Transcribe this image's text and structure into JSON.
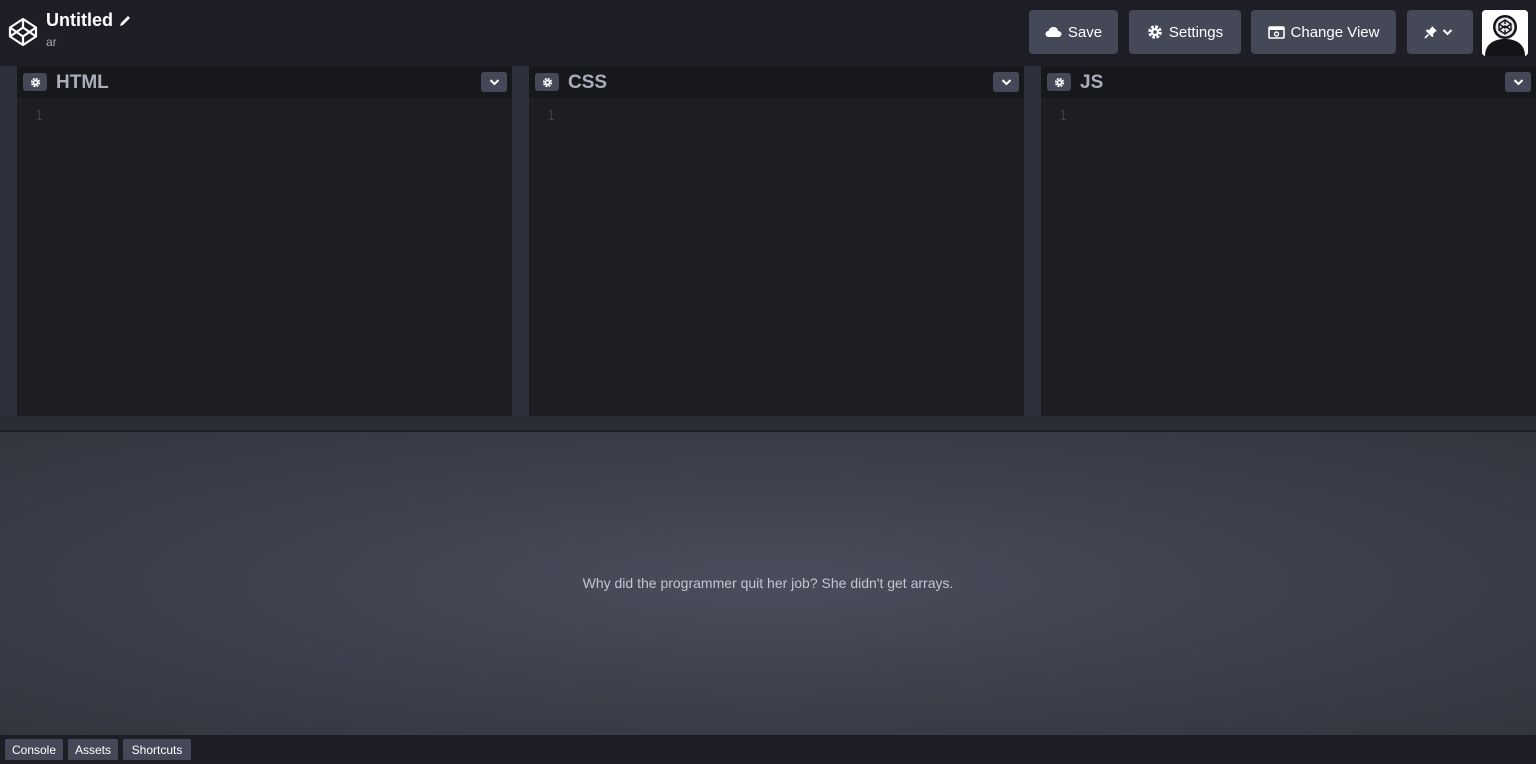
{
  "header": {
    "title": "Untitled",
    "user": "ar",
    "buttons": {
      "save": "Save",
      "settings": "Settings",
      "change_view": "Change View"
    },
    "icons": [
      "codepen-logo-icon",
      "pencil-icon",
      "cloud-icon",
      "gear-icon",
      "change-view-icon",
      "pin-icon",
      "chevron-down-icon",
      "avatar"
    ]
  },
  "editors": [
    {
      "title": "HTML",
      "line_number": "1"
    },
    {
      "title": "CSS",
      "line_number": "1"
    },
    {
      "title": "JS",
      "line_number": "1"
    }
  ],
  "preview": {
    "text": "Why did the programmer quit her job? She didn't get arrays."
  },
  "footer": {
    "console": "Console",
    "assets": "Assets",
    "shortcuts": "Shortcuts"
  },
  "colors": {
    "header_bg": "#1e1f26",
    "button_bg": "#444857",
    "editor_bg": "#1d1e22",
    "editor_title": "#aaaebc",
    "preview_bg": "#3e424e"
  }
}
